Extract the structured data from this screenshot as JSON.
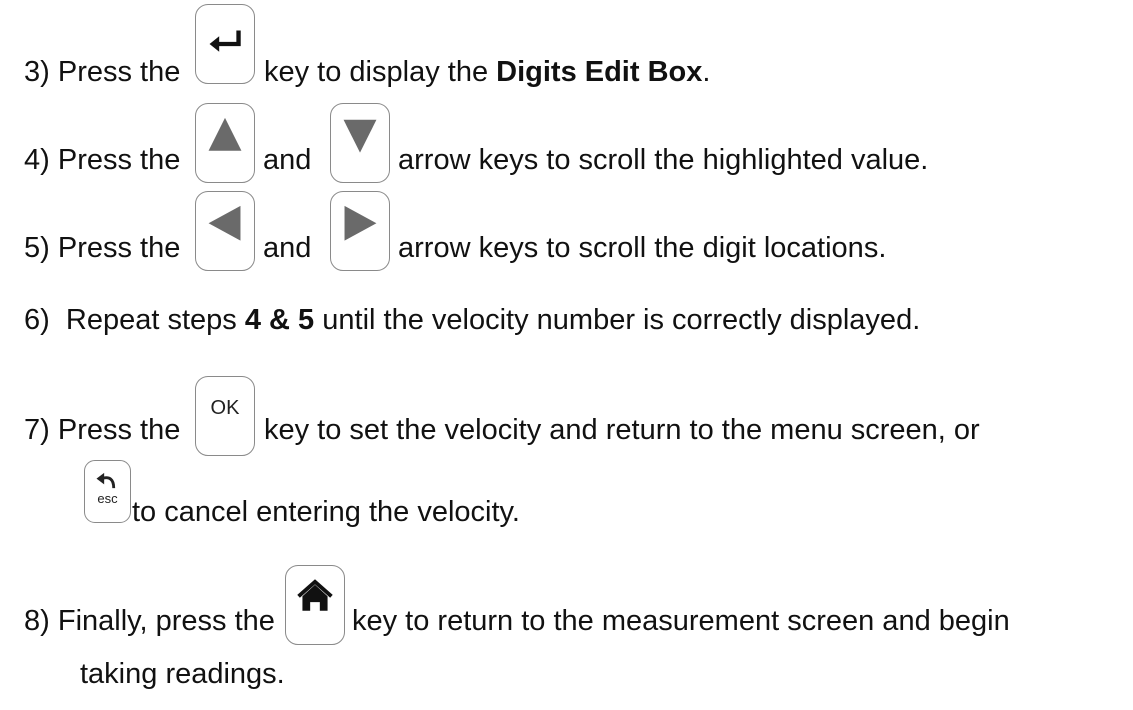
{
  "steps": [
    {
      "num": "3)",
      "parts": [
        "Press the",
        "key to display the",
        "Digits Edit Box",
        "."
      ]
    },
    {
      "num": "4)",
      "parts": [
        "Press the",
        "and",
        "arrow keys to scroll the highlighted value."
      ]
    },
    {
      "num": "5)",
      "parts": [
        "Press the",
        "and",
        "arrow keys to scroll the digit locations."
      ]
    },
    {
      "num": "6)",
      "parts": [
        "Repeat steps",
        "4 & 5",
        "until the velocity number is correctly displayed."
      ]
    },
    {
      "num": "7)",
      "parts": [
        "Press the",
        "key to set the velocity and return to the menu screen, or",
        "to cancel entering the velocity."
      ]
    },
    {
      "num": "8)",
      "parts": [
        "Finally, press the",
        "key to return to the measurement screen and begin",
        "taking readings."
      ]
    }
  ],
  "keys": {
    "ok_label": "OK",
    "esc_label": "esc",
    "icons": [
      "enter-icon",
      "up-arrow-icon",
      "down-arrow-icon",
      "left-arrow-icon",
      "right-arrow-icon",
      "ok-key",
      "esc-back-icon",
      "home-icon"
    ]
  }
}
